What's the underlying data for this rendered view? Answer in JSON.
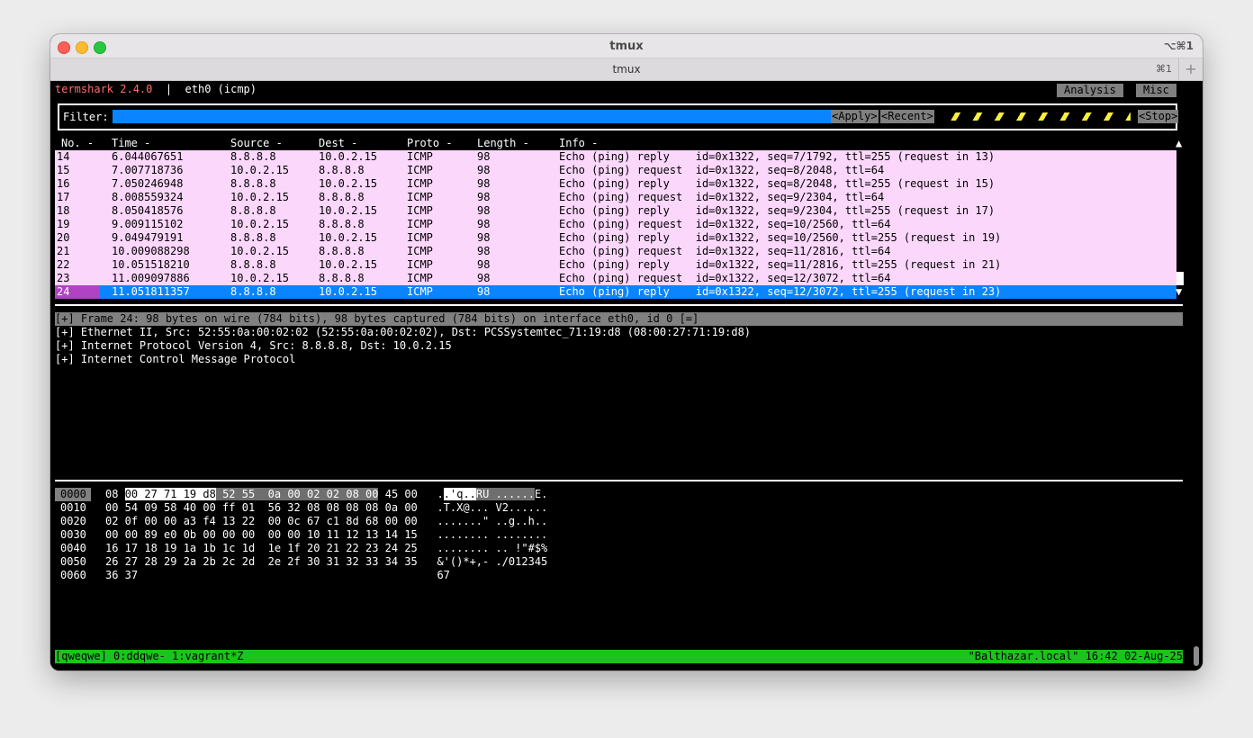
{
  "window": {
    "title": "tmux",
    "shortcut": "⌥⌘1"
  },
  "tab": {
    "label": "tmux",
    "shortcut": "⌘1",
    "add": "+"
  },
  "app": {
    "name": "termshark 2.4.0",
    "separator": "|",
    "interface": "eth0 (icmp)"
  },
  "menu": {
    "analysis": "Analysis",
    "misc": "Misc"
  },
  "filter": {
    "label": "Filter:",
    "value": "",
    "apply": "<Apply>",
    "recent": "<Recent>",
    "stop": "<Stop>"
  },
  "packet_list": {
    "headers": [
      "No. -",
      "Time -",
      "Source -",
      "Dest -",
      "Proto -",
      "Length -",
      "Info -"
    ],
    "rows": [
      [
        "14",
        "6.044067651",
        "8.8.8.8",
        "10.0.2.15",
        "ICMP",
        "98",
        "Echo (ping) reply    id=0x1322, seq=7/1792, ttl=255 (request in 13)"
      ],
      [
        "15",
        "7.007718736",
        "10.0.2.15",
        "8.8.8.8",
        "ICMP",
        "98",
        "Echo (ping) request  id=0x1322, seq=8/2048, ttl=64"
      ],
      [
        "16",
        "7.050246948",
        "8.8.8.8",
        "10.0.2.15",
        "ICMP",
        "98",
        "Echo (ping) reply    id=0x1322, seq=8/2048, ttl=255 (request in 15)"
      ],
      [
        "17",
        "8.008559324",
        "10.0.2.15",
        "8.8.8.8",
        "ICMP",
        "98",
        "Echo (ping) request  id=0x1322, seq=9/2304, ttl=64"
      ],
      [
        "18",
        "8.050418576",
        "8.8.8.8",
        "10.0.2.15",
        "ICMP",
        "98",
        "Echo (ping) reply    id=0x1322, seq=9/2304, ttl=255 (request in 17)"
      ],
      [
        "19",
        "9.009115102",
        "10.0.2.15",
        "8.8.8.8",
        "ICMP",
        "98",
        "Echo (ping) request  id=0x1322, seq=10/2560, ttl=64"
      ],
      [
        "20",
        "9.049479191",
        "8.8.8.8",
        "10.0.2.15",
        "ICMP",
        "98",
        "Echo (ping) reply    id=0x1322, seq=10/2560, ttl=255 (request in 19)"
      ],
      [
        "21",
        "10.009088298",
        "10.0.2.15",
        "8.8.8.8",
        "ICMP",
        "98",
        "Echo (ping) request  id=0x1322, seq=11/2816, ttl=64"
      ],
      [
        "22",
        "10.051518210",
        "8.8.8.8",
        "10.0.2.15",
        "ICMP",
        "98",
        "Echo (ping) reply    id=0x1322, seq=11/2816, ttl=255 (request in 21)"
      ],
      [
        "23",
        "11.009097886",
        "10.0.2.15",
        "8.8.8.8",
        "ICMP",
        "98",
        "Echo (ping) request  id=0x1322, seq=12/3072, ttl=64"
      ],
      [
        "24",
        "11.051811357",
        "8.8.8.8",
        "10.0.2.15",
        "ICMP",
        "98",
        "Echo (ping) reply    id=0x1322, seq=12/3072, ttl=255 (request in 23)"
      ]
    ],
    "scroll_up": "▲",
    "scroll_down": "▼"
  },
  "details": [
    "[+] Frame 24: 98 bytes on wire (784 bits), 98 bytes captured (784 bits) on interface eth0, id 0 [=]",
    "[+] Ethernet II, Src: 52:55:0a:00:02:02 (52:55:0a:00:02:02), Dst: PCSSystemtec_71:19:d8 (08:00:27:71:19:d8)",
    "[+] Internet Protocol Version 4, Src: 8.8.8.8, Dst: 10.0.2.15",
    "[+] Internet Control Message Protocol"
  ],
  "hexdump": {
    "offsets": [
      "0000",
      "0010",
      "0020",
      "0030",
      "0040",
      "0050",
      "0060"
    ],
    "first_row": {
      "pre": "08",
      "hl_dst": "00 27 71 19 d8",
      "hl_src": "52 55  0a 00 02 02",
      "hl_type": "08 00",
      "rest": "45 00",
      "ascii_pre": ".",
      "ascii_dst": ".'q..",
      "ascii_src": "RU ......",
      "ascii_rest": "E."
    },
    "rows": [
      "00 54 09 58 40 00 ff 01  56 32 08 08 08 08 0a 00   .T.X@... V2......",
      "02 0f 00 00 a3 f4 13 22  00 0c 67 c1 8d 68 00 00   .......\" ..g..h..",
      "00 00 89 e0 0b 00 00 00  00 00 10 11 12 13 14 15   ........ ........",
      "16 17 18 19 1a 1b 1c 1d  1e 1f 20 21 22 23 24 25   ........ .. !\"#$%",
      "26 27 28 29 2a 2b 2c 2d  2e 2f 30 31 32 33 34 35   &'()*+,- ./012345",
      "36 37                                              67"
    ]
  },
  "status": {
    "left": "[qweqwe] 0:ddqwe- 1:vagrant*Z",
    "right": "\"Balthazar.local\" 16:42 02-Aug-25"
  },
  "colors": {
    "selected_row": "#0a84ff",
    "packet_row": "#fcd7fc",
    "status_bar": "#1cc31c",
    "brand": "#ff6d6d"
  }
}
